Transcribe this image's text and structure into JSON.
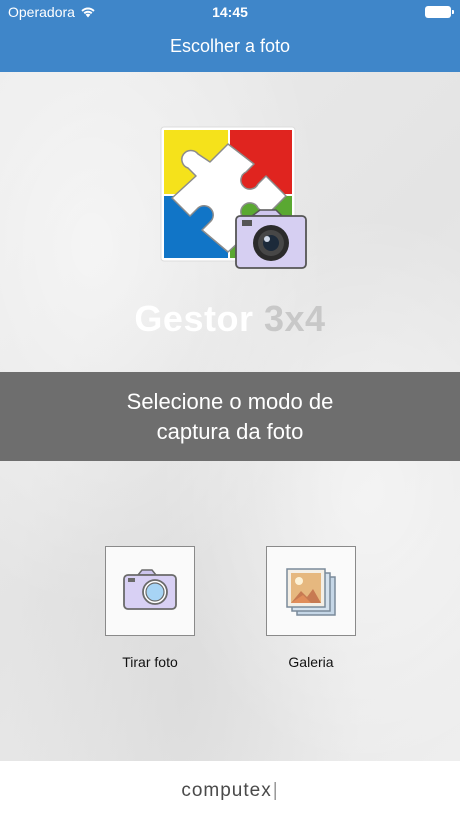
{
  "status_bar": {
    "carrier": "Operadora",
    "time": "14:45",
    "icons": [
      "wifi-icon",
      "battery-icon"
    ]
  },
  "nav": {
    "title": "Escolher a foto"
  },
  "app": {
    "name_part1": "Gestor",
    "name_part2": "3x4",
    "logo_icon": "puzzle-camera-logo"
  },
  "banner": {
    "line1": "Selecione o modo de",
    "line2": "captura da foto"
  },
  "options": [
    {
      "label": "Tirar foto",
      "icon": "camera-icon"
    },
    {
      "label": "Galeria",
      "icon": "gallery-icon"
    }
  ],
  "footer": {
    "brand": "computex",
    "brand_cursor": "|"
  },
  "colors": {
    "accent": "#3f86c9",
    "banner": "#6e6e6e",
    "icon_purple": "#d3ccf0"
  }
}
